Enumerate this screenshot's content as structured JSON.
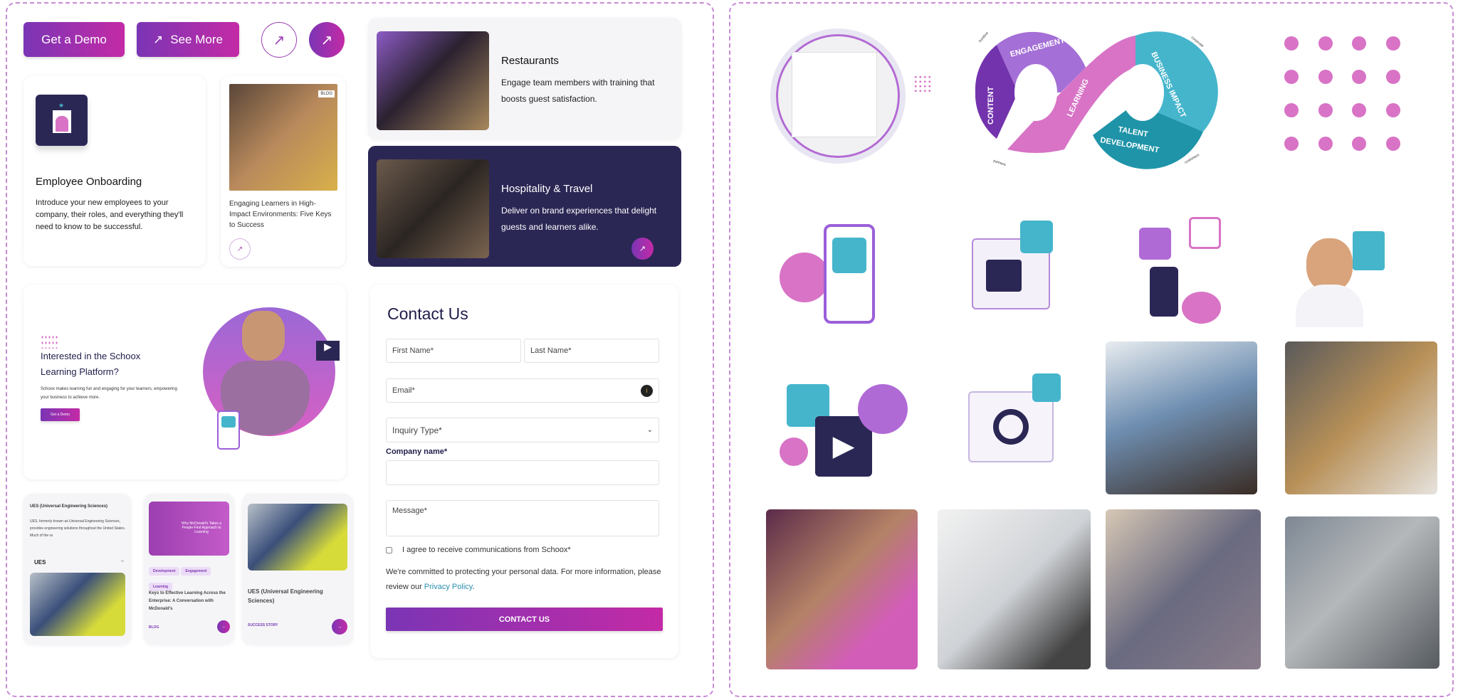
{
  "buttons": {
    "get_demo": "Get a Demo",
    "see_more": "See More"
  },
  "onboarding": {
    "title": "Employee Onboarding",
    "desc": "Introduce your new employees to your company, their roles, and everything they'll need to know to be successful."
  },
  "blog_card": {
    "badge": "BLOG",
    "title": "Engaging Learners in High-Impact Environments: Five Keys to Success"
  },
  "restaurants": {
    "title": "Restaurants",
    "desc": "Engage team members with training that boosts guest satisfaction."
  },
  "hospitality": {
    "title": "Hospitality & Travel",
    "desc": "Deliver on brand experiences that delight guests and learners alike."
  },
  "promo": {
    "title": "Interested in the Schoox Learning Platform?",
    "desc": "Schoox makes learning fun and engaging for your learners, empowering your business to achieve more.",
    "button": "Get a Demo"
  },
  "contact": {
    "title": "Contact Us",
    "first_name": "First Name*",
    "last_name": "Last Name*",
    "email": "Email*",
    "inquiry": "Inquiry Type*",
    "company_label": "Company name*",
    "company_value": "",
    "message": "Message*",
    "agree": "I agree to receive communications from Schoox*",
    "privacy_text": "We're committed to protecting your personal data. For more information, please review our ",
    "privacy_link": "Privacy Policy",
    "privacy_end": ".",
    "submit": "CONTACT US"
  },
  "cards": [
    {
      "title": "UES (Universal Engineering Sciences)",
      "desc": "UES, formerly known as Universal Engineering Sciences, provides engineering solutions throughout the United States. Much of the ra",
      "logo": "UES"
    },
    {
      "banner": "Why McDonald's Takes a People-First Approach to Learning",
      "tags": [
        "Development",
        "Engagement",
        "Learning"
      ],
      "title": "Keys to Effective Learning Across the Enterprise: A Conversation with McDonald's",
      "type": "BLOG"
    },
    {
      "title": "UES (Universal Engineering Sciences)",
      "type": "SUCCESS STORY"
    }
  ],
  "infinity": {
    "segments": [
      "ENGAGEMENT",
      "CONTENT",
      "LEARNING",
      "BUSINESS IMPACT",
      "TALENT",
      "DEVELOPMENT"
    ],
    "arrows": [
      "frontline",
      "corporate",
      "partners",
      "customers"
    ]
  },
  "colors": {
    "brand_start": "#7a35b5",
    "brand_end": "#c42aa6",
    "navy": "#2b2755",
    "pink": "#d873c6",
    "teal": "#45b5cc"
  }
}
